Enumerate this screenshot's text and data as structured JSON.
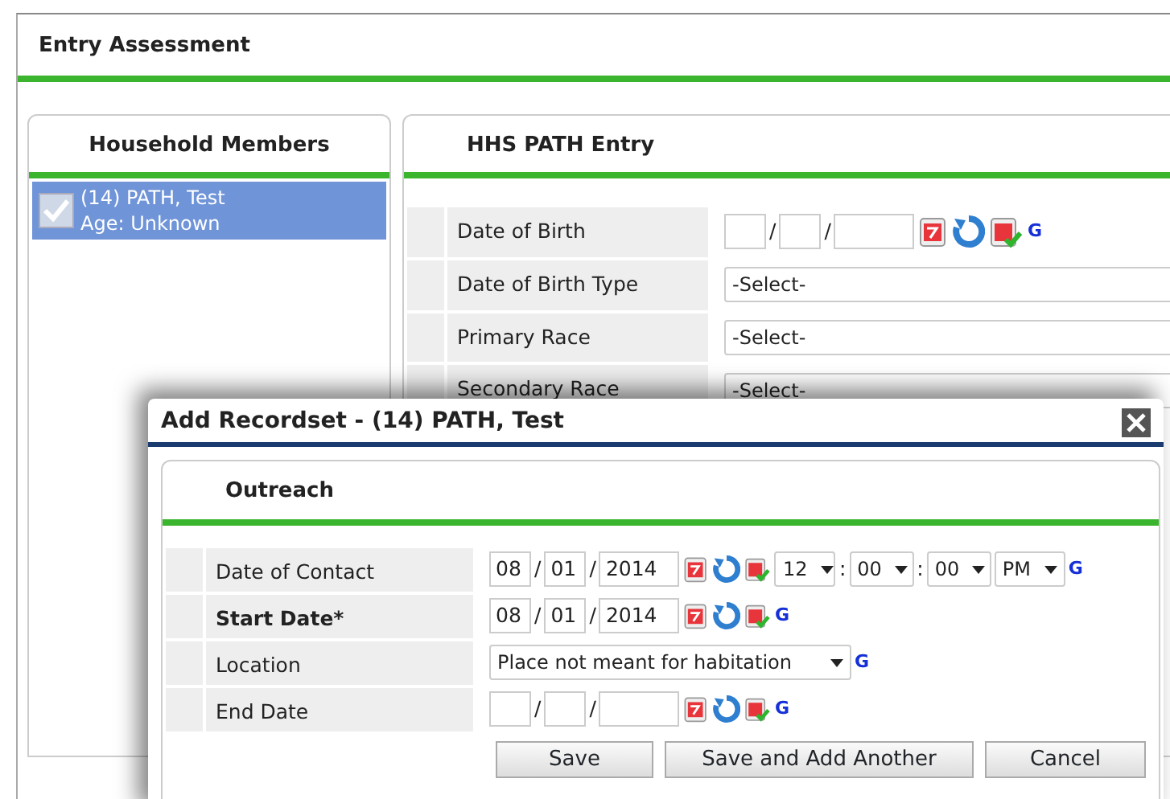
{
  "page": {
    "title": "Entry Assessment"
  },
  "separators": {
    "date": "/",
    "time": ":"
  },
  "household": {
    "title": "Household Members",
    "members": [
      {
        "name": "(14) PATH, Test",
        "age": "Age: Unknown",
        "checked": true,
        "selected": true
      }
    ]
  },
  "entry": {
    "title": "HHS PATH Entry",
    "fields": [
      {
        "kind": "date",
        "label": "Date of Birth",
        "link": "G"
      },
      {
        "kind": "select",
        "label": "Date of Birth Type",
        "value": "-Select-"
      },
      {
        "kind": "select",
        "label": "Primary Race",
        "value": "-Select-"
      },
      {
        "kind": "select",
        "label": "Secondary Race",
        "value": "-Select-"
      }
    ]
  },
  "dialog": {
    "title": "Add Recordset - (14) PATH, Test",
    "section": "Outreach",
    "fields": [
      {
        "kind": "datetime",
        "label": "Date of Contact",
        "required": false,
        "month": "08",
        "day": "01",
        "year": "2014",
        "hour": "12",
        "minute": "00",
        "second": "00",
        "ampm": "PM",
        "link": "G"
      },
      {
        "kind": "date",
        "label": "Start Date*",
        "required": true,
        "month": "08",
        "day": "01",
        "year": "2014",
        "link": "G"
      },
      {
        "kind": "select",
        "label": "Location",
        "required": false,
        "value": "Place not meant for habitation",
        "link": "G"
      },
      {
        "kind": "date",
        "label": "End Date",
        "required": false,
        "link": "G"
      }
    ],
    "buttons": [
      "Save",
      "Save and Add Another",
      "Cancel"
    ]
  }
}
